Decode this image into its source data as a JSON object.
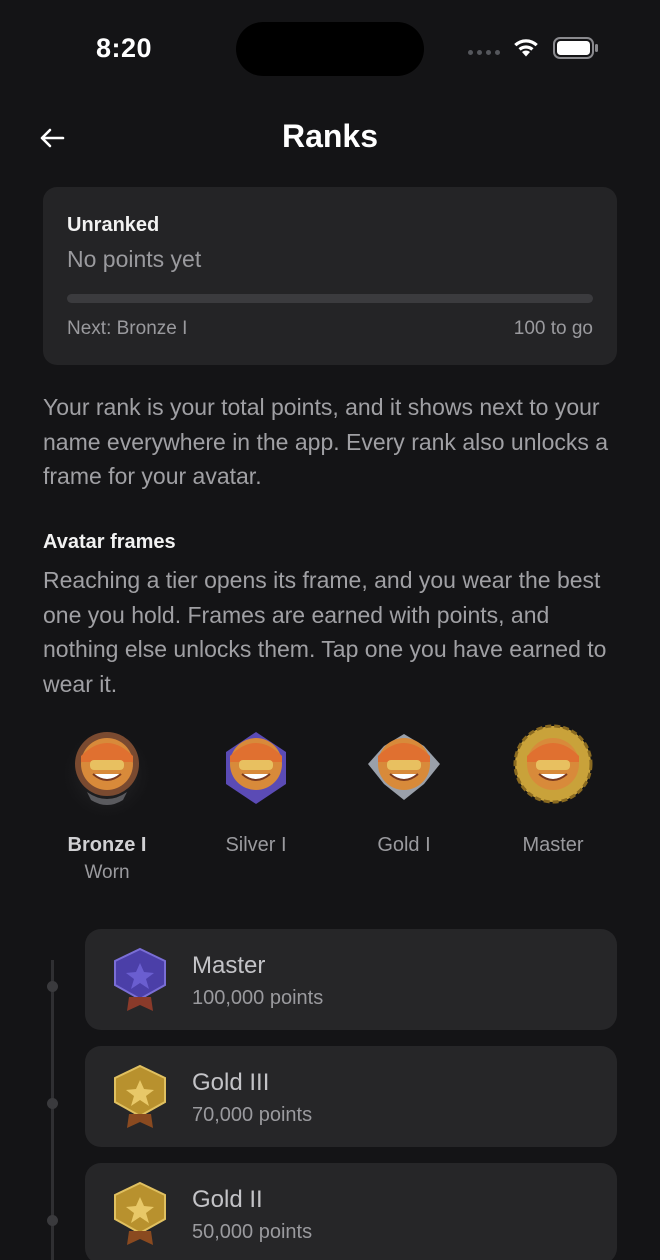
{
  "status_bar": {
    "time": "8:20"
  },
  "header": {
    "title": "Ranks"
  },
  "progress_card": {
    "rank": "Unranked",
    "points": "No points yet",
    "progress_fraction": 0,
    "next_label": "Next: Bronze I",
    "remaining": "100 to go"
  },
  "intro": "Your rank is your total points, and it shows next to your name everywhere in the app. Every rank also unlocks a frame for your avatar.",
  "avatar_frames": {
    "heading": "Avatar frames",
    "description": "Reaching a tier opens its frame, and you wear the best one you hold. Frames are earned with points, and nothing else unlocks them. Tap one you have earned to wear it.",
    "items": [
      {
        "label": "Bronze I",
        "status": "Worn",
        "frame_color": "#8a5a3a"
      },
      {
        "label": "Silver I",
        "status": "",
        "frame_color": "#5b4bb5"
      },
      {
        "label": "Gold I",
        "status": "",
        "frame_color": "#9aa0aa"
      },
      {
        "label": "Master",
        "status": "",
        "frame_color": "#c9a23a"
      }
    ]
  },
  "tiers": [
    {
      "name": "Master",
      "points": "100,000 points",
      "badge_color": "#4b3fa8",
      "badge_icon": "master-badge-icon"
    },
    {
      "name": "Gold III",
      "points": "70,000 points",
      "badge_color": "#b8912e",
      "badge_icon": "gold-badge-icon"
    },
    {
      "name": "Gold II",
      "points": "50,000 points",
      "badge_color": "#b8912e",
      "badge_icon": "gold-badge-icon"
    }
  ],
  "colors": {
    "background": "#141416",
    "card": "#242426",
    "muted_text": "#9a9a9e"
  }
}
